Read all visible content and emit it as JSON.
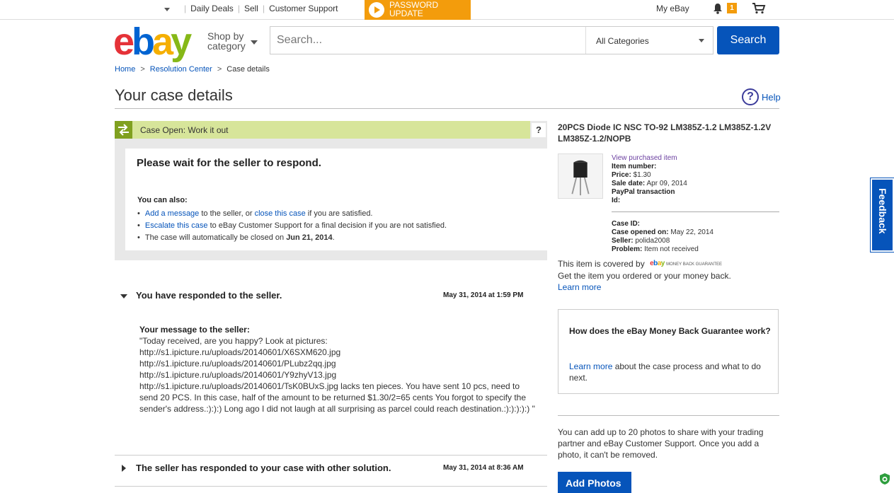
{
  "topbar": {
    "daily_deals": "Daily Deals",
    "sell": "Sell",
    "customer_support": "Customer Support",
    "password_line1": "PASSWORD",
    "password_line2": "UPDATE",
    "my_ebay": "My eBay",
    "notification_count": "1"
  },
  "header": {
    "logo_e": "e",
    "logo_b": "b",
    "logo_a": "a",
    "logo_y": "y",
    "shop_by_1": "Shop by",
    "shop_by_2": "category",
    "search_placeholder": "Search...",
    "category": "All Categories",
    "search_button": "Search"
  },
  "breadcrumb": {
    "home": "Home",
    "resolution_center": "Resolution Center",
    "current": "Case details",
    "separator": ">"
  },
  "page": {
    "title": "Your case details",
    "help": "Help",
    "help_mark": "?"
  },
  "status": {
    "label": "Case Open: Work it out",
    "q": "?",
    "heading": "Please wait for the seller to respond.",
    "also": "You can also:",
    "item1_link1": "Add a message",
    "item1_mid": " to the seller, or ",
    "item1_link2": "close this case",
    "item1_end": " if you are satisfied.",
    "item2_link": "Escalate this case",
    "item2_end": " to eBay Customer Support for a final decision if you are not satisfied.",
    "item3_start": "The case will automatically be closed on ",
    "item3_date": "Jun 21, 2014",
    "item3_end": "."
  },
  "responses": [
    {
      "title": "You have responded to the seller.",
      "date": "May 31, 2014 at 1:59 PM",
      "message_label": "Your message to the seller:",
      "message": "\"Today received, are you happy? Look at pictures:\nhttp://s1.ipicture.ru/uploads/20140601/X6SXM620.jpg\nhttp://s1.ipicture.ru/uploads/20140601/PLubz2qq.jpg\nhttp://s1.ipicture.ru/uploads/20140601/Y9zhyV13.jpg\nhttp://s1.ipicture.ru/uploads/20140601/TsK0BUxS.jpg lacks ten pieces. You have sent 10 pcs, need to send 20 PCS. In this case, half of the amount to be returned $1.30/2=65 cents You forgot to specify the sender's address.:):):) Long ago I did not laugh at all surprising as parcel could reach destination.:):):):):) \""
    },
    {
      "title": "The seller has responded to your case with other solution.",
      "date": "May 31, 2014 at 8:36 AM"
    }
  ],
  "item": {
    "title": "20PCS Diode IC NSC TO-92 LM385Z-1.2 LM385Z-1.2V LM385Z-1.2/NOPB",
    "view_link": "View purchased item",
    "item_number_label": "Item number:",
    "price_label": "Price:",
    "price": "$1.30",
    "sale_date_label": "Sale date:",
    "sale_date": "Apr 09, 2014",
    "paypal_label": "PayPal transaction",
    "paypal_id_label": "Id:"
  },
  "case": {
    "case_id_label": "Case ID:",
    "opened_label": "Case opened on:",
    "opened": "May 22, 2014",
    "seller_label": "Seller:",
    "seller": "polida2008",
    "problem_label": "Problem:",
    "problem": "Item not received"
  },
  "coverage": {
    "line1": "This item is covered by",
    "mbg_text": "MONEY BACK GUARANTEE",
    "line2": "Get the item you ordered or your money back.",
    "learn_more": "Learn more"
  },
  "mbg_box": {
    "heading": "How does the eBay Money Back Guarantee work?",
    "link": "Learn more",
    "text": " about the case process and what to do next."
  },
  "photos": {
    "text": "You can add up to 20 photos to share with your trading partner and eBay Customer Support. Once you add a photo, it can't be removed.",
    "button": "Add Photos"
  },
  "feedback": {
    "label": "Feedback"
  },
  "colors": {
    "brand_blue": "#0654ba",
    "status_green": "#d7e59a",
    "accent_orange": "#f39c0c"
  }
}
